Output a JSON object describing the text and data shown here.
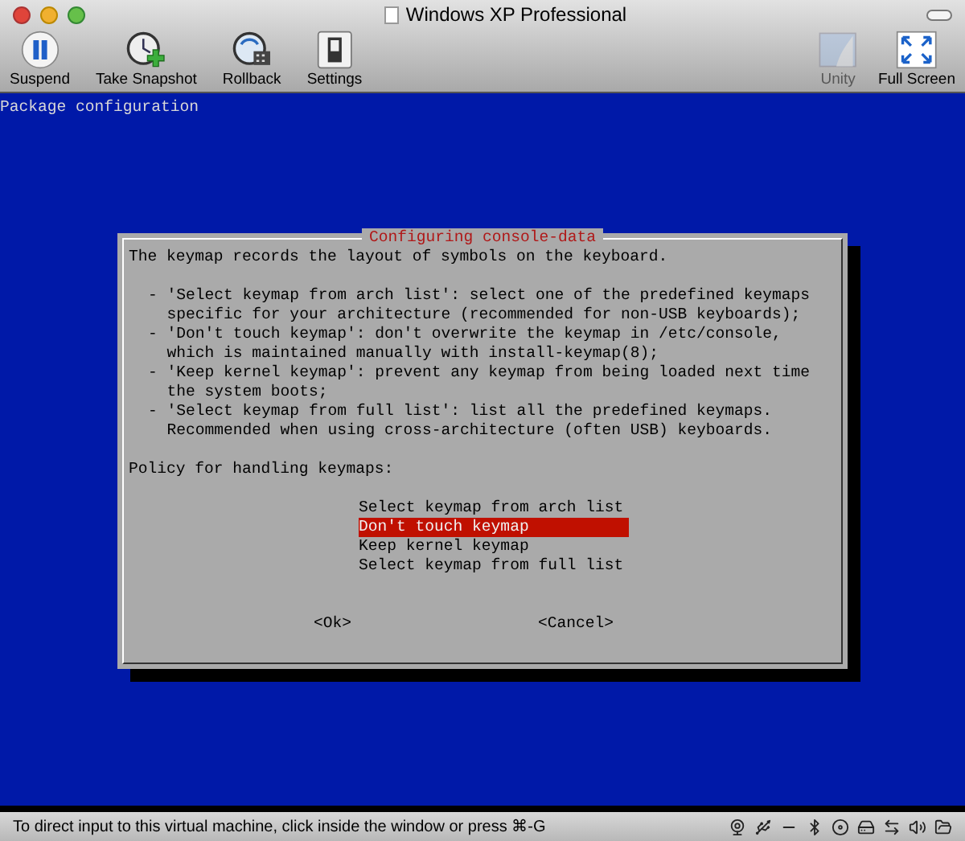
{
  "window": {
    "title": "Windows XP Professional"
  },
  "toolbar": {
    "left": [
      {
        "label": "Suspend",
        "kind": "pause",
        "disabled": false
      },
      {
        "label": "Take Snapshot",
        "kind": "snapshot",
        "disabled": false
      },
      {
        "label": "Rollback",
        "kind": "rollback",
        "disabled": false
      },
      {
        "label": "Settings",
        "kind": "settings",
        "disabled": false
      }
    ],
    "right": [
      {
        "label": "Unity",
        "kind": "unity",
        "disabled": true
      },
      {
        "label": "Full Screen",
        "kind": "fullscreen",
        "disabled": false
      }
    ]
  },
  "console": {
    "heading": "Package configuration",
    "dialog": {
      "title": "Configuring console-data",
      "description": "The keymap records the layout of symbols on the keyboard.",
      "bullets": [
        "- 'Select keymap from arch list': select one of the predefined keymaps\n  specific for your architecture (recommended for non-USB keyboards);",
        "- 'Don't touch keymap': don't overwrite the keymap in /etc/console,\n  which is maintained manually with install-keymap(8);",
        "- 'Keep kernel keymap': prevent any keymap from being loaded next time\n  the system boots;",
        "- 'Select keymap from full list': list all the predefined keymaps.\n  Recommended when using cross-architecture (often USB) keyboards."
      ],
      "prompt": "Policy for handling keymaps:",
      "options": [
        {
          "label": "Select keymap from arch list",
          "selected": false
        },
        {
          "label": "Don't touch keymap",
          "selected": true
        },
        {
          "label": "Keep kernel keymap",
          "selected": false
        },
        {
          "label": "Select keymap from full list",
          "selected": false
        }
      ],
      "buttons": [
        "<Ok>",
        "<Cancel>"
      ]
    }
  },
  "status_bar": {
    "text": "To direct input to this virtual machine, click inside the window or press ⌘-G"
  }
}
